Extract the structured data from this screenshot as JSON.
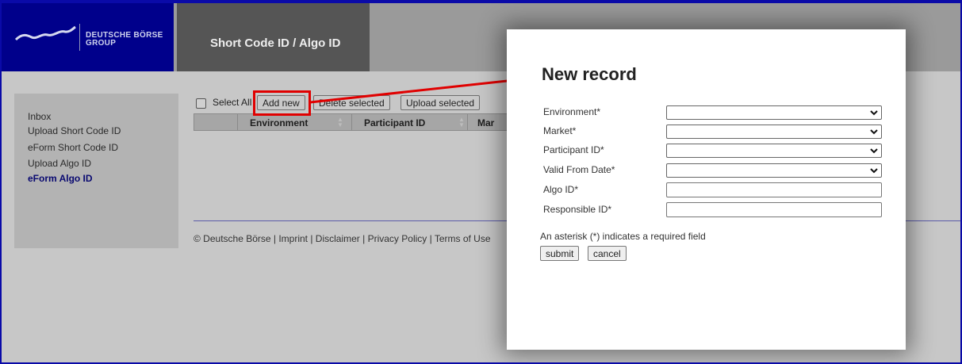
{
  "brand": {
    "line1": "DEUTSCHE BÖRSE",
    "line2": "GROUP"
  },
  "header": {
    "section_title": "Short Code ID / Algo ID"
  },
  "sidebar": {
    "items": [
      {
        "label": "Inbox",
        "active": false
      },
      {
        "label": "Upload Short Code ID",
        "active": false
      },
      {
        "label": "eForm Short Code ID",
        "active": false
      },
      {
        "label": "Upload Algo ID",
        "active": false
      },
      {
        "label": "eForm Algo ID",
        "active": true
      }
    ]
  },
  "toolbar": {
    "select_all_label": "Select All",
    "add_new_label": "Add new",
    "delete_selected_label": "Delete selected",
    "upload_selected_label": "Upload selected"
  },
  "grid": {
    "columns": [
      "Environment",
      "Participant ID",
      "Mar"
    ]
  },
  "footer": {
    "text": "© Deutsche Börse | Imprint | Disclaimer | Privacy Policy | Terms of Use"
  },
  "modal": {
    "title": "New record",
    "fields": [
      {
        "label": "Environment*",
        "type": "select",
        "value": ""
      },
      {
        "label": "Market*",
        "type": "select",
        "value": ""
      },
      {
        "label": "Participant ID*",
        "type": "select",
        "value": ""
      },
      {
        "label": "Valid From Date*",
        "type": "select",
        "value": ""
      },
      {
        "label": "Algo ID*",
        "type": "text",
        "value": ""
      },
      {
        "label": "Responsible ID*",
        "type": "text",
        "value": ""
      }
    ],
    "required_note": "An asterisk (*) indicates a required field",
    "submit_label": "submit",
    "cancel_label": "cancel"
  },
  "colors": {
    "brand_blue": "#00008b",
    "annotation_red": "#e00000",
    "frame_blue": "#0a0aa8"
  }
}
